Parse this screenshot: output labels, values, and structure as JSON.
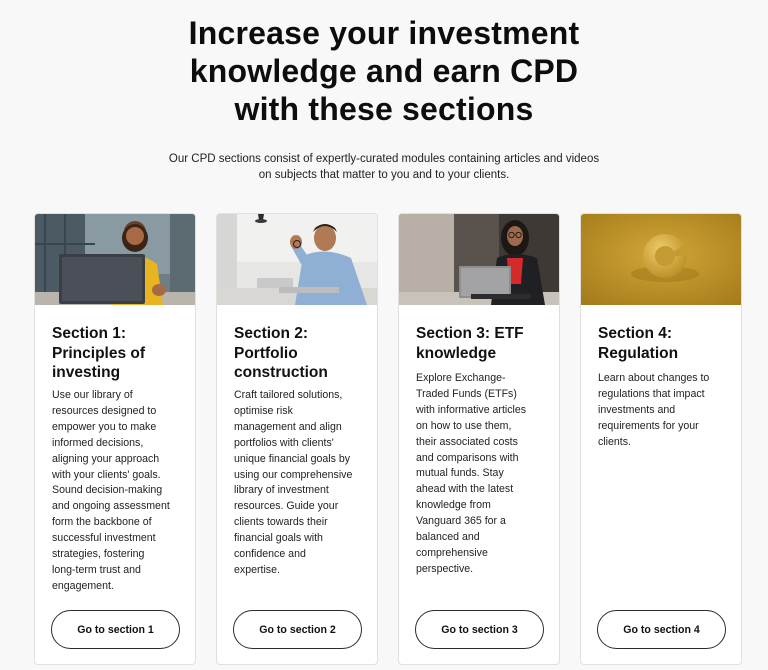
{
  "hero": {
    "title_lines": [
      "Increase your investment",
      "knowledge and earn CPD",
      "with these sections"
    ],
    "subtitle_lines": [
      "Our CPD sections consist of expertly-curated modules containing articles and videos",
      "on subjects that matter to you and to your clients."
    ]
  },
  "cards": [
    {
      "title_lines": [
        "Section 1:",
        "Principles of",
        "investing"
      ],
      "body_lines": [
        "Use our library of",
        "resources designed to",
        "empower you to make",
        "informed decisions,",
        "aligning your approach",
        "with your clients' goals.",
        "Sound decision-making",
        "and ongoing assessment",
        "form the backbone of",
        "successful investment",
        "strategies, fostering",
        "long-term trust and",
        "engagement."
      ],
      "button_label": "Go to section 1",
      "image_alt": "woman-smiling-at-laptop-photo"
    },
    {
      "title_lines": [
        "Section 2:",
        "Portfolio",
        "construction"
      ],
      "body_lines": [
        "Craft tailored solutions,",
        "optimise risk",
        "management and align",
        "portfolios with clients'",
        "unique financial goals by",
        "using our comprehensive",
        "library of investment",
        "resources. Guide your",
        "clients towards their",
        "financial goals with",
        "confidence and",
        "expertise."
      ],
      "button_label": "Go to section 2",
      "image_alt": "man-thinking-at-desk-photo"
    },
    {
      "title_lines": [
        "Section 3: ETF",
        "knowledge"
      ],
      "body_lines": [
        "Explore Exchange-",
        "Traded Funds (ETFs)",
        "with informative articles",
        "on how to use them,",
        "their associated costs",
        "and comparisons with",
        "mutual funds. Stay",
        "ahead with the latest",
        "knowledge from",
        "Vanguard 365 for a",
        "balanced and",
        "comprehensive",
        "perspective."
      ],
      "button_label": "Go to section 3",
      "image_alt": "woman-working-on-laptop-photo"
    },
    {
      "title_lines": [
        "Section 4:",
        "Regulation"
      ],
      "body_lines": [
        "Learn about changes to",
        "regulations that impact",
        "investments and",
        "requirements for your",
        "clients."
      ],
      "button_label": "Go to section 4",
      "image_alt": "golden-abstract-shape-photo"
    }
  ],
  "colors": {
    "page_bg": "#f8f8f8",
    "card_bg": "#ffffff",
    "text": "#111111",
    "section4_gold": "#c89a2a"
  }
}
